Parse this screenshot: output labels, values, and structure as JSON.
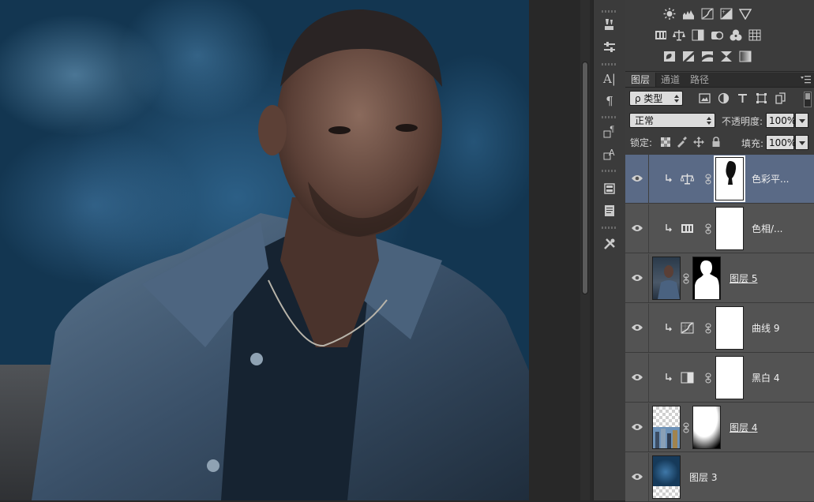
{
  "tool_strip": {
    "tools": [
      {
        "icon": "brush-preset-icon"
      },
      {
        "icon": "brush-settings-icon"
      },
      {
        "icon": "character-icon",
        "glyph": "A|"
      },
      {
        "icon": "paragraph-icon",
        "glyph": "¶"
      },
      {
        "icon": "character-style-icon"
      },
      {
        "icon": "paragraph-style-icon"
      },
      {
        "icon": "properties-icon"
      },
      {
        "icon": "notes-icon"
      },
      {
        "icon": "tool-presets-icon"
      }
    ]
  },
  "adjustments": {
    "row1": [
      "brightness-contrast-icon",
      "levels-icon",
      "curves-icon",
      "exposure-icon",
      "vibrance-icon"
    ],
    "row2": [
      "hue-saturation-icon",
      "color-balance-icon",
      "black-white-icon",
      "photo-filter-icon",
      "channel-mixer-icon",
      "color-lookup-icon"
    ],
    "row3": [
      "invert-icon",
      "posterize-icon",
      "threshold-icon",
      "selective-color-icon",
      "gradient-map-icon"
    ]
  },
  "layers_panel": {
    "tabs": [
      "图层",
      "通道",
      "路径"
    ],
    "active_tab": 0,
    "filter": {
      "kind_label": "ρ 类型"
    },
    "filter_icons": [
      "pixel-filter-icon",
      "adjustment-filter-icon",
      "type-filter-icon",
      "shape-filter-icon",
      "smart-object-filter-icon"
    ],
    "blend_mode": "正常",
    "opacity_label": "不透明度:",
    "opacity_value": "100%",
    "lock_label": "锁定:",
    "fill_label": "填充:",
    "fill_value": "100%",
    "layers": [
      {
        "name": "色彩平...",
        "kind": "color-balance",
        "clipped": true,
        "selected": true,
        "underlined": false
      },
      {
        "name": "色相/...",
        "kind": "hue-saturation",
        "clipped": true,
        "selected": false,
        "underlined": false
      },
      {
        "name": "图层 5",
        "kind": "pixel-masked",
        "clipped": false,
        "selected": false,
        "underlined": true
      },
      {
        "name": "曲线 9",
        "kind": "curves",
        "clipped": true,
        "selected": false,
        "underlined": false
      },
      {
        "name": "黑白 4",
        "kind": "black-white",
        "clipped": true,
        "selected": false,
        "underlined": false
      },
      {
        "name": "图层 4",
        "kind": "pixel-masked",
        "clipped": false,
        "selected": false,
        "underlined": true
      },
      {
        "name": "图层 3",
        "kind": "pixel",
        "clipped": false,
        "selected": false,
        "underlined": false
      }
    ]
  },
  "colors": {
    "selected_row": "#5a6a86",
    "row": "#535353",
    "panel": "#3c3c3c"
  }
}
